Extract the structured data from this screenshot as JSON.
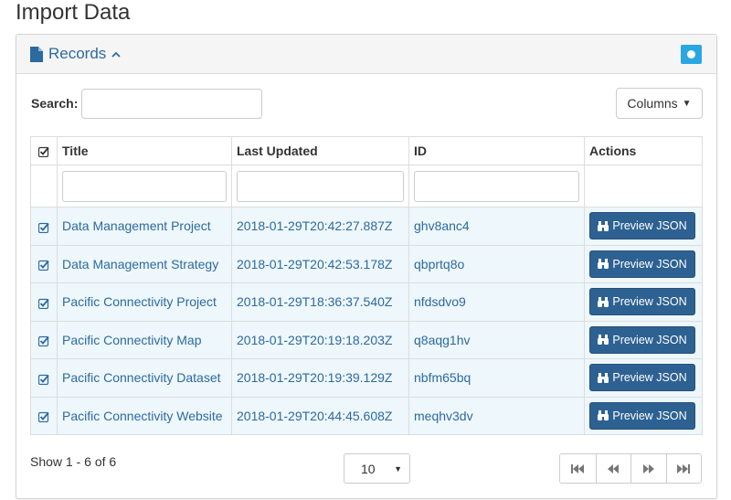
{
  "page": {
    "title": "Import Data"
  },
  "panel": {
    "title": "Records",
    "title_icon": "file-icon",
    "collapse_icon": "chevron-up-icon",
    "toggle_color": "#2aa7e0"
  },
  "search": {
    "label": "Search:",
    "value": "",
    "placeholder": ""
  },
  "columns_button": {
    "label": "Columns",
    "icon": "caret-down-icon"
  },
  "table": {
    "headers": {
      "select": "",
      "title": "Title",
      "updated": "Last Updated",
      "id": "ID",
      "actions": "Actions"
    },
    "rows": [
      {
        "checked": true,
        "title": "Data Management Project",
        "updated": "2018-01-29T20:42:27.887Z",
        "id": "ghv8anc4",
        "action": "Preview JSON"
      },
      {
        "checked": true,
        "title": "Data Management Strategy",
        "updated": "2018-01-29T20:42:53.178Z",
        "id": "qbprtq8o",
        "action": "Preview JSON"
      },
      {
        "checked": true,
        "title": "Pacific Connectivity Project",
        "updated": "2018-01-29T18:36:37.540Z",
        "id": "nfdsdvo9",
        "action": "Preview JSON"
      },
      {
        "checked": true,
        "title": "Pacific Connectivity Map",
        "updated": "2018-01-29T20:19:18.203Z",
        "id": "q8aqg1hv",
        "action": "Preview JSON"
      },
      {
        "checked": true,
        "title": "Pacific Connectivity Dataset",
        "updated": "2018-01-29T20:19:39.129Z",
        "id": "nbfm65bq",
        "action": "Preview JSON"
      },
      {
        "checked": true,
        "title": "Pacific Connectivity Website",
        "updated": "2018-01-29T20:44:45.608Z",
        "id": "meqhv3dv",
        "action": "Preview JSON"
      }
    ],
    "row_color": "#eef7fb",
    "link_color": "#2c6aa0",
    "button_color": "#2d6192"
  },
  "footer": {
    "show_text": "Show 1 - 6 of 6",
    "page_size": "10",
    "pager_icons": [
      "first-page-icon",
      "previous-page-icon",
      "next-page-icon",
      "last-page-icon"
    ]
  }
}
